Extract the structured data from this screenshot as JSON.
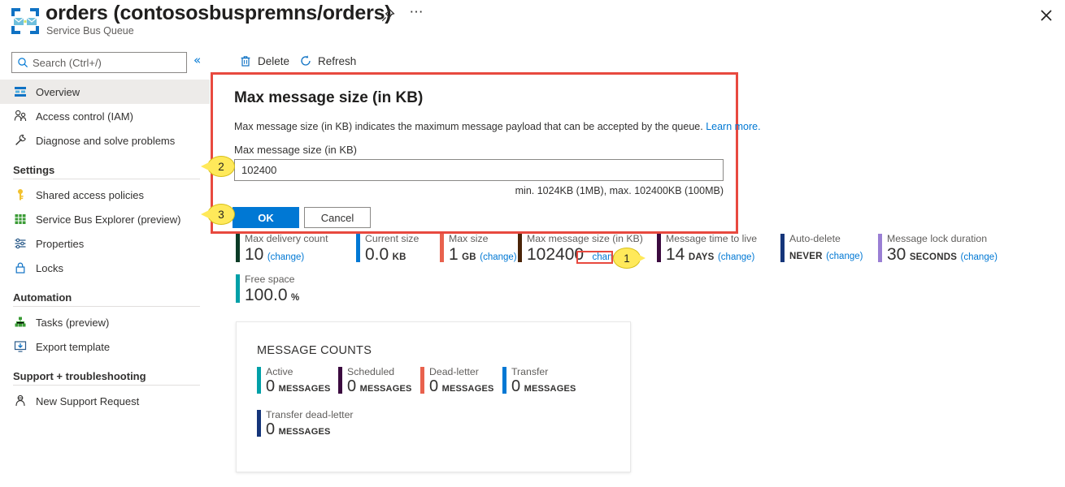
{
  "header": {
    "title": "orders (contososbuspremns/orders)",
    "subtitle": "Service Bus Queue",
    "icon": "service-bus-queue-icon",
    "pin_icon": "pin-icon",
    "more_icon": "ellipsis-icon",
    "close_icon": "close-icon"
  },
  "sidebar": {
    "search": {
      "placeholder": "Search (Ctrl+/)",
      "value": "",
      "icon": "search-icon"
    },
    "collapse_icon": "«",
    "items": [
      {
        "label": "Overview",
        "icon": "overview-icon",
        "selected": true
      },
      {
        "label": "Access control (IAM)",
        "icon": "users-icon",
        "selected": false
      },
      {
        "label": "Diagnose and solve problems",
        "icon": "wrench-icon",
        "selected": false
      }
    ],
    "groups": [
      {
        "title": "Settings",
        "items": [
          {
            "label": "Shared access policies",
            "icon": "key-icon"
          },
          {
            "label": "Service Bus Explorer (preview)",
            "icon": "grid-icon"
          },
          {
            "label": "Properties",
            "icon": "sliders-icon"
          },
          {
            "label": "Locks",
            "icon": "lock-icon"
          }
        ]
      },
      {
        "title": "Automation",
        "items": [
          {
            "label": "Tasks (preview)",
            "icon": "tasks-icon"
          },
          {
            "label": "Export template",
            "icon": "export-template-icon"
          }
        ]
      },
      {
        "title": "Support + troubleshooting",
        "items": [
          {
            "label": "New Support Request",
            "icon": "support-person-icon"
          }
        ]
      }
    ]
  },
  "toolbar": {
    "delete_label": "Delete",
    "delete_icon": "trash-icon",
    "refresh_label": "Refresh",
    "refresh_icon": "refresh-icon"
  },
  "tiles": [
    {
      "label": "Max delivery count",
      "value": "10",
      "unit": "",
      "change": "(change)",
      "color": "#0b3b26"
    },
    {
      "label": "Current size",
      "value": "0.0",
      "unit": "KB",
      "change": "",
      "color": "#0078d4"
    },
    {
      "label": "Max size",
      "value": "1",
      "unit": "GB",
      "change": "(change)",
      "color": "#e8614d"
    },
    {
      "label": "Max message size (in KB)",
      "value": "102400",
      "unit": "",
      "change": "change",
      "color": "#4a2408"
    },
    {
      "label": "Message time to live",
      "value": "14",
      "unit": "DAYS",
      "change": "(change)",
      "color": "#3b0a3f"
    },
    {
      "label": "Auto-delete",
      "value": "",
      "unit": "NEVER",
      "change": "(change)",
      "color": "#15357a"
    },
    {
      "label": "Message lock duration",
      "value": "30",
      "unit": "SECONDS",
      "change": "(change)",
      "color": "#9a7fd4"
    },
    {
      "label": "Free space",
      "value": "100.0",
      "unit": "%",
      "change": "",
      "color": "#00a0a8"
    }
  ],
  "message_counts": {
    "title": "MESSAGE COUNTS",
    "items": [
      {
        "label": "Active",
        "value": "0",
        "unit": "MESSAGES",
        "color": "#00a0a8"
      },
      {
        "label": "Scheduled",
        "value": "0",
        "unit": "MESSAGES",
        "color": "#3b0a3f"
      },
      {
        "label": "Dead-letter",
        "value": "0",
        "unit": "MESSAGES",
        "color": "#e8614d"
      },
      {
        "label": "Transfer",
        "value": "0",
        "unit": "MESSAGES",
        "color": "#0078d4"
      },
      {
        "label": "Transfer dead-letter",
        "value": "0",
        "unit": "MESSAGES",
        "color": "#15357a"
      }
    ]
  },
  "dialog": {
    "title": "Max message size (in KB)",
    "description": "Max message size (in KB) indicates the maximum message payload that can be accepted by the queue.",
    "learn_more": "Learn more.",
    "field_label": "Max message size (in KB)",
    "field_value": "102400",
    "hint": "min. 1024KB (1MB), max. 102400KB (100MB)",
    "ok_label": "OK",
    "cancel_label": "Cancel"
  },
  "annotations": {
    "badge1": "1",
    "badge2": "2",
    "badge3": "3",
    "accent_red": "#e8493f",
    "badge_yellow": "#ffe95a"
  }
}
